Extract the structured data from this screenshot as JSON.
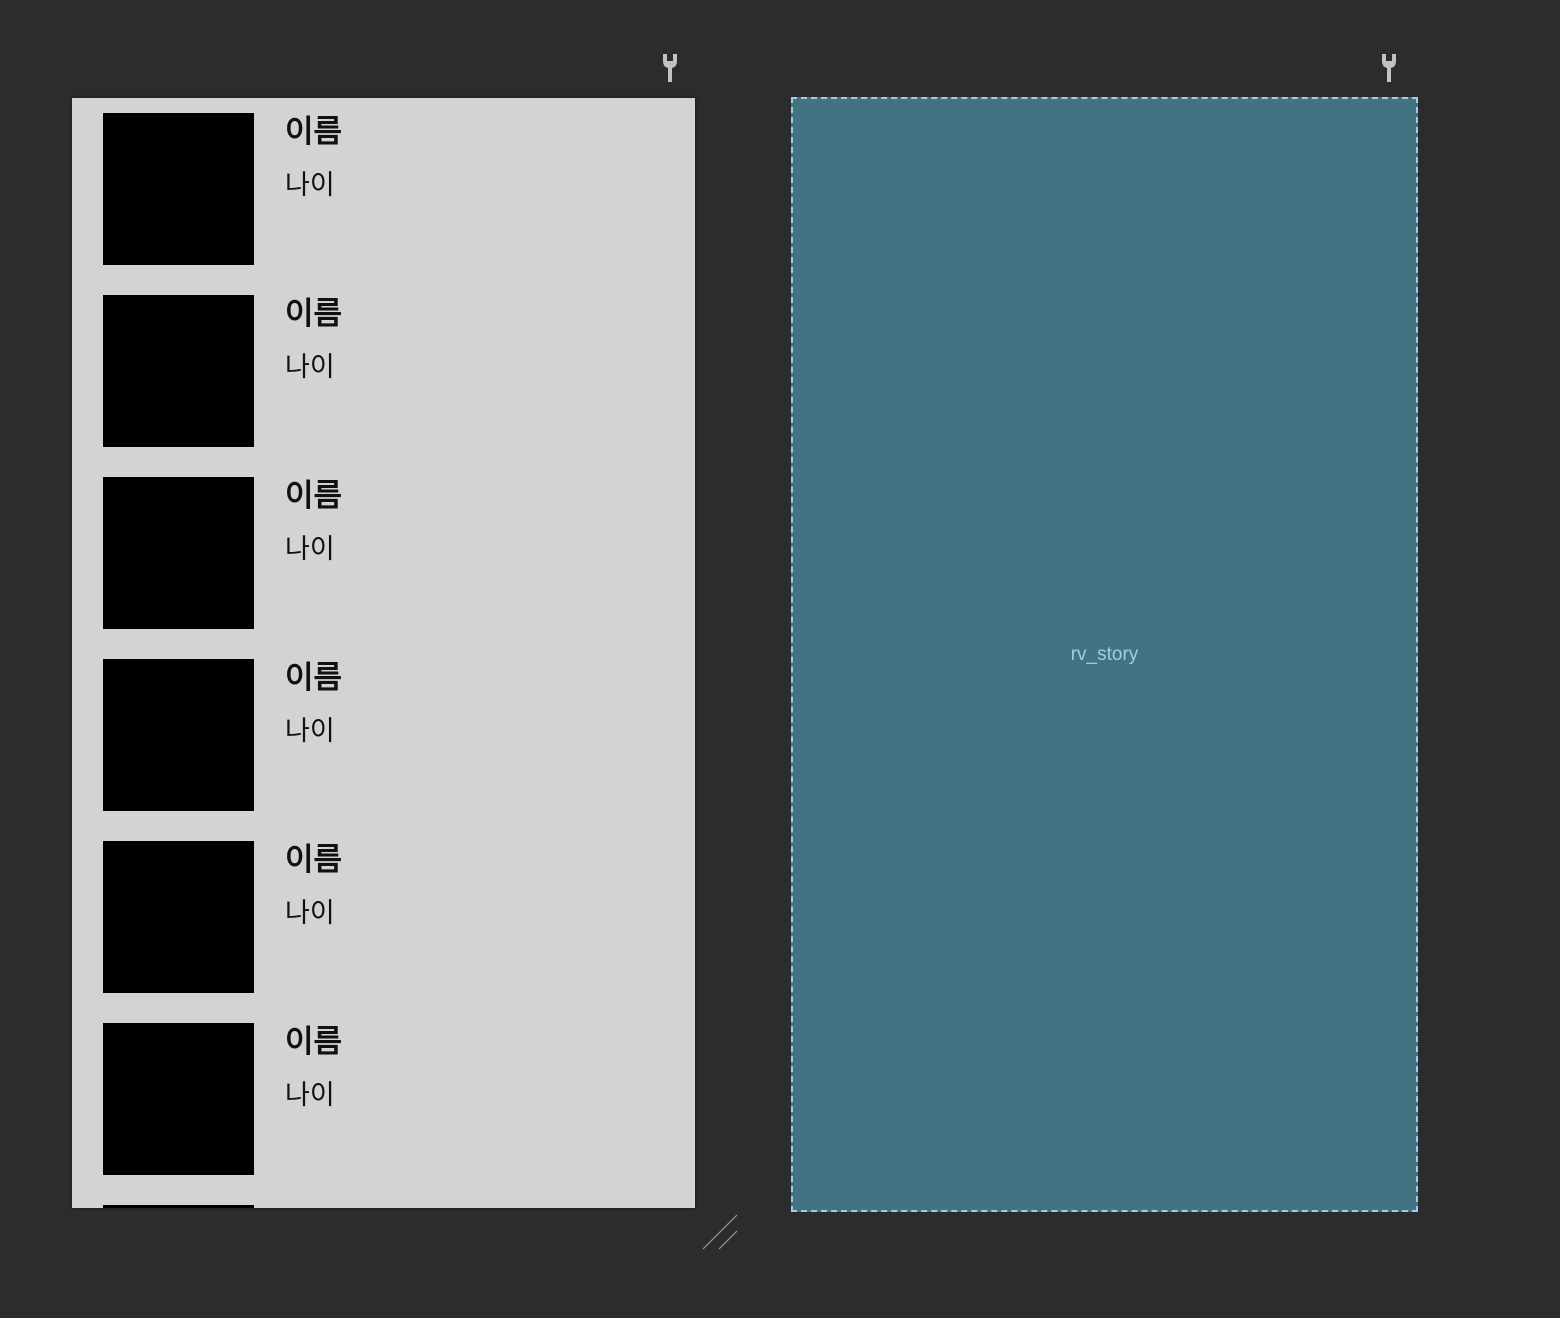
{
  "design_preview": {
    "items": [
      {
        "name": "이름",
        "age": "나이"
      },
      {
        "name": "이름",
        "age": "나이"
      },
      {
        "name": "이름",
        "age": "나이"
      },
      {
        "name": "이름",
        "age": "나이"
      },
      {
        "name": "이름",
        "age": "나이"
      },
      {
        "name": "이름",
        "age": "나이"
      },
      {
        "name": "",
        "age": ""
      }
    ]
  },
  "blueprint_preview": {
    "label": "rv_story"
  },
  "icons": {
    "design_tools": "wrench-icon",
    "blueprint_tools": "wrench-icon",
    "resize": "resize-handle-icon"
  },
  "colors": {
    "background": "#2b2c2e",
    "design_surface": "#d3d3d3",
    "image_placeholder": "#000000",
    "blueprint_fill": "#437283",
    "blueprint_outline": "#9ccfe4"
  }
}
